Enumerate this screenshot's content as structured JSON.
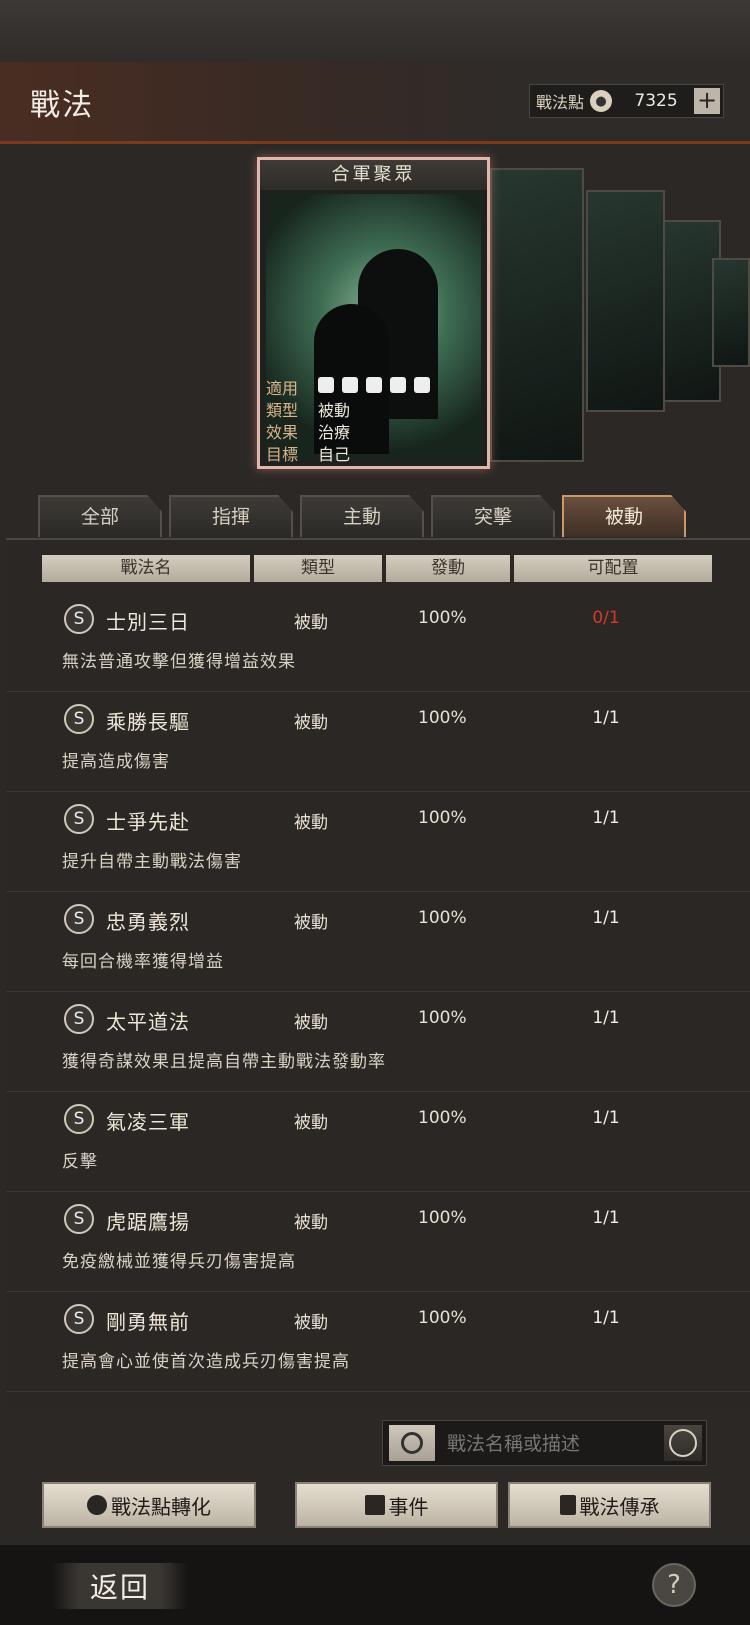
{
  "header": {
    "title": "戰法",
    "points_label": "戰法點",
    "points_value": "7325",
    "plus_label": "+"
  },
  "card": {
    "name": "合軍聚眾",
    "stats": [
      {
        "key": "適用",
        "value": ""
      },
      {
        "key": "類型",
        "value": "被動"
      },
      {
        "key": "效果",
        "value": "治療"
      },
      {
        "key": "目標",
        "value": "自己"
      }
    ]
  },
  "tabs": [
    {
      "label": "全部"
    },
    {
      "label": "指揮"
    },
    {
      "label": "主動"
    },
    {
      "label": "突擊"
    },
    {
      "label": "被動",
      "active": true
    }
  ],
  "columns": [
    "戰法名",
    "類型",
    "發動",
    "可配置"
  ],
  "tactics": [
    {
      "grade": "S",
      "name": "士別三日",
      "type": "被動",
      "rate": "100%",
      "slots": "0/1",
      "desc": "無法普通攻擊但獲得增益效果"
    },
    {
      "grade": "S",
      "name": "乘勝長驅",
      "type": "被動",
      "rate": "100%",
      "slots": "1/1",
      "desc": "提高造成傷害"
    },
    {
      "grade": "S",
      "name": "士爭先赴",
      "type": "被動",
      "rate": "100%",
      "slots": "1/1",
      "desc": "提升自帶主動戰法傷害"
    },
    {
      "grade": "S",
      "name": "忠勇義烈",
      "type": "被動",
      "rate": "100%",
      "slots": "1/1",
      "desc": "每回合機率獲得增益"
    },
    {
      "grade": "S",
      "name": "太平道法",
      "type": "被動",
      "rate": "100%",
      "slots": "1/1",
      "desc": "獲得奇謀效果且提高自帶主動戰法發動率"
    },
    {
      "grade": "S",
      "name": "氣凌三軍",
      "type": "被動",
      "rate": "100%",
      "slots": "1/1",
      "desc": "反擊"
    },
    {
      "grade": "S",
      "name": "虎踞鷹揚",
      "type": "被動",
      "rate": "100%",
      "slots": "1/1",
      "desc": "免疫繳械並獲得兵刃傷害提高"
    },
    {
      "grade": "S",
      "name": "剛勇無前",
      "type": "被動",
      "rate": "100%",
      "slots": "1/1",
      "desc": "提高會心並使首次造成兵刃傷害提高"
    }
  ],
  "search": {
    "placeholder": "戰法名稱或描述"
  },
  "actions": {
    "convert": "戰法點轉化",
    "events": "事件",
    "inherit": "戰法傳承"
  },
  "footer": {
    "back": "返回",
    "help": "?"
  }
}
